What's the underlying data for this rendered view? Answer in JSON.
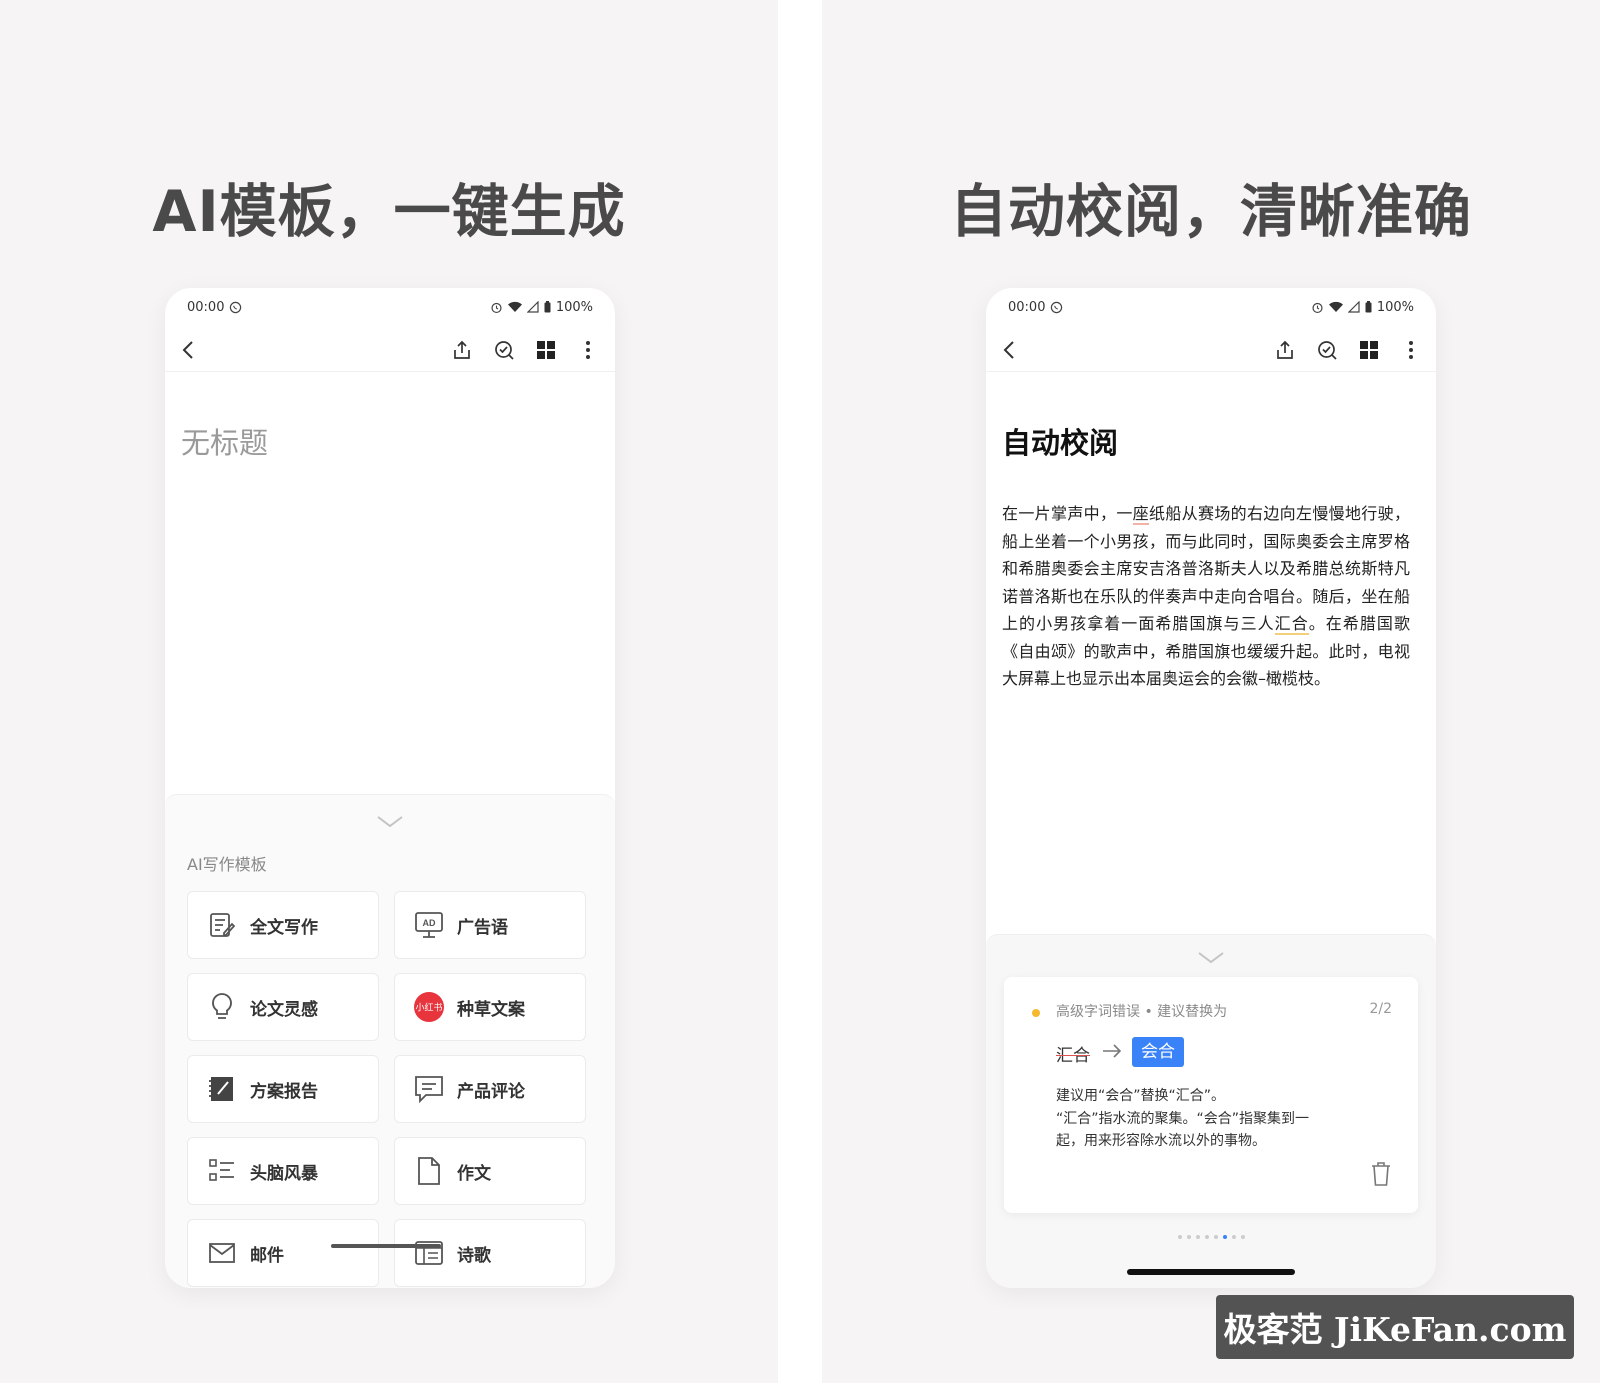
{
  "left_panel": {
    "headline": "AI模板，一键生成",
    "status": {
      "time": "00:00",
      "battery": "100%"
    },
    "doc": {
      "title_placeholder": "无标题"
    },
    "sheet": {
      "label": "AI写作模板",
      "templates": [
        {
          "label": "全文写作",
          "icon": "edit-doc-icon"
        },
        {
          "label": "广告语",
          "icon": "ad-board-icon"
        },
        {
          "label": "论文灵感",
          "icon": "lightbulb-icon"
        },
        {
          "label": "种草文案",
          "icon": "xiaohongshu-icon",
          "badge_text": "小红书"
        },
        {
          "label": "方案报告",
          "icon": "report-icon"
        },
        {
          "label": "产品评论",
          "icon": "comment-icon"
        },
        {
          "label": "头脑风暴",
          "icon": "list-icon"
        },
        {
          "label": "作文",
          "icon": "file-icon"
        },
        {
          "label": "邮件",
          "icon": "mail-icon"
        },
        {
          "label": "诗歌",
          "icon": "poem-icon"
        }
      ]
    }
  },
  "right_panel": {
    "headline": "自动校阅，清晰准确",
    "status": {
      "time": "00:00",
      "battery": "100%"
    },
    "doc": {
      "title": "自动校阅",
      "body_part1": "在一片掌声中，一",
      "body_mark1": "座",
      "body_part2": "纸船从赛场的右边向左慢慢地行驶，船上坐着一个小男孩，而与此同时，国际奥委会主席罗格和希腊奥委会主席安吉洛普洛斯夫人以及希腊总统斯特凡诺普洛斯也在乐队的伴奏声中走向合唱台。随后，坐在船上的小男孩拿着一面希腊国旗与三人",
      "body_mark2": "汇合",
      "body_part3": "。在希腊国歌《自由颂》的歌声中，希腊国旗也缓缓升起。此时，电视大屏幕上也显示出本届奥运会的会徽–橄榄枝。"
    },
    "suggestion": {
      "type": "高级字词错误 • 建议替换为",
      "count": "2/2",
      "original": "汇合",
      "replacement": "会合",
      "desc_line1": "建议用“会合”替换“汇合”。",
      "desc_line2": "“汇合”指水流的聚集。“会合”指聚集到一起，用来形容除水流以外的事物。",
      "accent_color": "#3a82f7",
      "warning_color": "#f5b82e"
    },
    "pager": {
      "total": 8,
      "active_index": 5
    }
  },
  "watermark": "极客范 JiKeFan.com"
}
